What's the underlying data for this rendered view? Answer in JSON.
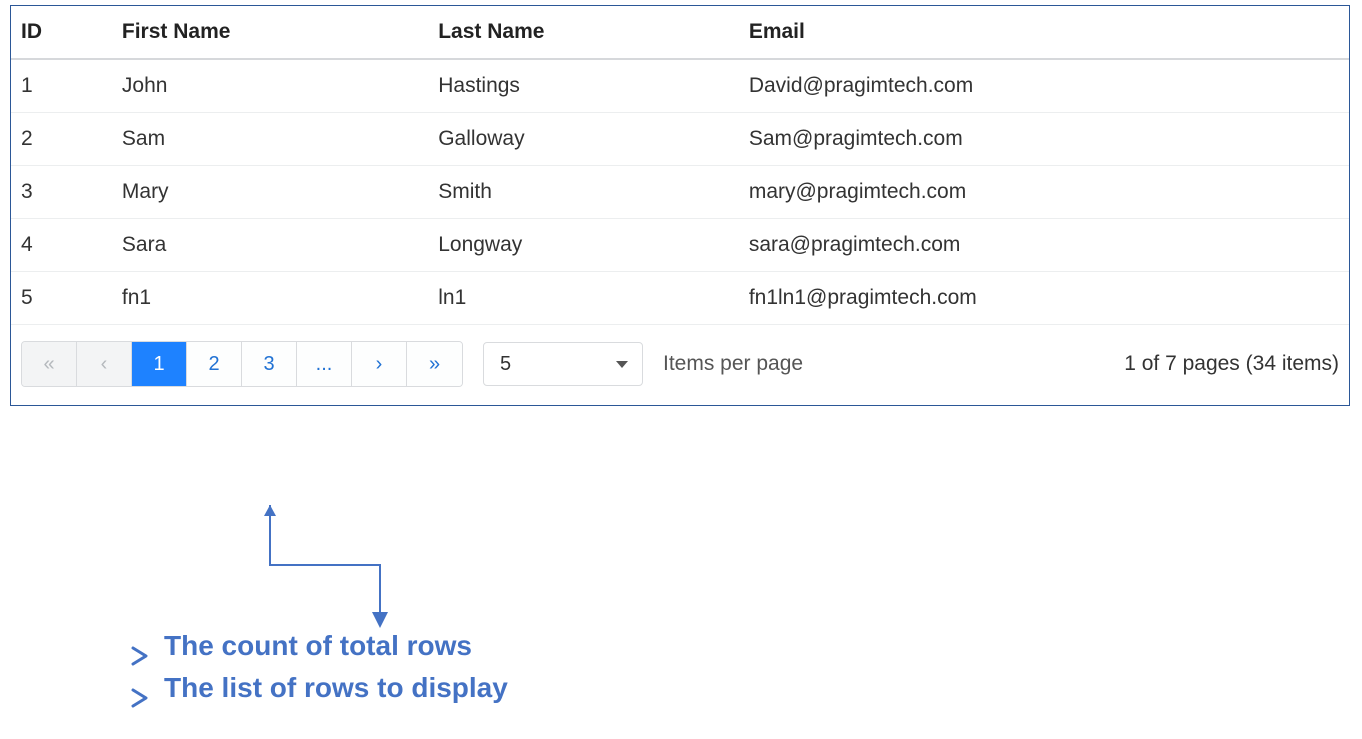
{
  "grid": {
    "headers": [
      "ID",
      "First Name",
      "Last Name",
      "Email"
    ],
    "rows": [
      {
        "id": "1",
        "first": "John",
        "last": "Hastings",
        "email": "David@pragimtech.com"
      },
      {
        "id": "2",
        "first": "Sam",
        "last": "Galloway",
        "email": "Sam@pragimtech.com"
      },
      {
        "id": "3",
        "first": "Mary",
        "last": "Smith",
        "email": "mary@pragimtech.com"
      },
      {
        "id": "4",
        "first": "Sara",
        "last": "Longway",
        "email": "sara@pragimtech.com"
      },
      {
        "id": "5",
        "first": "fn1",
        "last": "ln1",
        "email": "fn1ln1@pragimtech.com"
      }
    ]
  },
  "pager": {
    "first": "«",
    "prev": "‹",
    "pages": [
      "1",
      "2",
      "3"
    ],
    "active_index": 0,
    "ellipsis": "...",
    "next": "›",
    "last": "»"
  },
  "page_size": {
    "value": "5"
  },
  "footer": {
    "label": "Items per page",
    "summary": "1 of 7 pages (34 items)"
  },
  "annotations": {
    "line1": "The count of total rows",
    "line2": "The list of rows to display"
  }
}
